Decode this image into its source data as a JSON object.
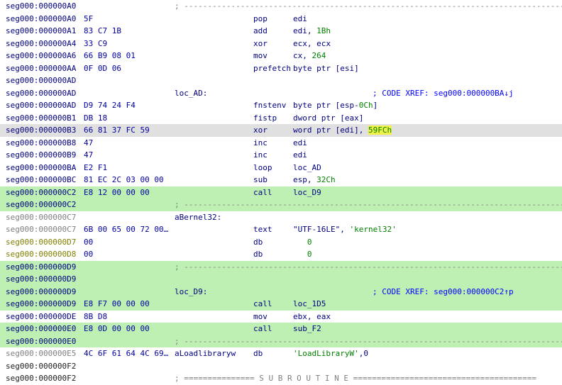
{
  "listing": {
    "rows": [
      {
        "addr": "seg000:000000A0",
        "addrColor": "default",
        "sep": "; ---------------------------------------------------------------------------------------"
      },
      {
        "addr": "seg000:000000A0",
        "bytes": "5F",
        "mnem": "pop",
        "ops": "edi"
      },
      {
        "addr": "seg000:000000A1",
        "bytes": "83 C7 1B",
        "mnem": "add",
        "ops": "edi, ",
        "num": "1Bh"
      },
      {
        "addr": "seg000:000000A4",
        "bytes": "33 C9",
        "mnem": "xor",
        "ops": "ecx, ecx"
      },
      {
        "addr": "seg000:000000A6",
        "bytes": "66 B9 08 01",
        "mnem": "mov",
        "ops": "cx, ",
        "num": "264"
      },
      {
        "addr": "seg000:000000AA",
        "bytes": "0F 0D 06",
        "mnem": "prefetch",
        "ops": "byte ptr [esi]"
      },
      {
        "addr": "seg000:000000AD"
      },
      {
        "addr": "seg000:000000AD",
        "label": "loc_AD:",
        "comment": "; CODE XREF: seg000:000000BA↓j"
      },
      {
        "addr": "seg000:000000AD",
        "bytes": "D9 74 24 F4",
        "mnem": "fnstenv",
        "ops": "byte ptr [esp-",
        "num": "0Ch",
        "opsTail": "]"
      },
      {
        "addr": "seg000:000000B1",
        "bytes": "DB 18",
        "mnem": "fistp",
        "ops": "dword ptr [eax]"
      },
      {
        "addr": "seg000:000000B3",
        "bytes": "66 81 37 FC 59",
        "mnem": "xor",
        "ops": "word ptr [edi], ",
        "hl": "59FCh",
        "selected": true
      },
      {
        "addr": "seg000:000000B8",
        "bytes": "47",
        "mnem": "inc",
        "ops": "edi"
      },
      {
        "addr": "seg000:000000B9",
        "bytes": "47",
        "mnem": "inc",
        "ops": "edi"
      },
      {
        "addr": "seg000:000000BA",
        "bytes": "E2 F1",
        "mnem": "loop",
        "ops": "loc_AD"
      },
      {
        "addr": "seg000:000000BC",
        "bytes": "81 EC 2C 03 00 00",
        "mnem": "sub",
        "ops": "esp, ",
        "num": "32Ch"
      },
      {
        "addr": "seg000:000000C2",
        "bytes": "E8 12 00 00 00",
        "mnem": "call",
        "ops": "loc_D9",
        "green": true
      },
      {
        "addr": "seg000:000000C2",
        "sep": "; ---------------------------------------------------------------------------------------",
        "green": true
      },
      {
        "addr": "seg000:000000C7",
        "addrColor": "gray",
        "label": "aBernel32:"
      },
      {
        "addr": "seg000:000000C7",
        "addrColor": "gray",
        "bytes": "6B 00 65 00 72 00…",
        "mnem": "text",
        "ops": "\"UTF-16LE\", ",
        "str": "'kernel32'"
      },
      {
        "addr": "seg000:000000D7",
        "addrColor": "data",
        "bytes": "00",
        "mnem": "db",
        "num": "   0"
      },
      {
        "addr": "seg000:000000D8",
        "addrColor": "data",
        "bytes": "00",
        "mnem": "db",
        "num": "   0"
      },
      {
        "addr": "seg000:000000D9",
        "sep": "; ---------------------------------------------------------------------------------------",
        "green": true
      },
      {
        "addr": "seg000:000000D9",
        "green": true
      },
      {
        "addr": "seg000:000000D9",
        "label": "loc_D9:",
        "comment": "; CODE XREF: seg000:000000C2↑p",
        "green": true
      },
      {
        "addr": "seg000:000000D9",
        "bytes": "E8 F7 00 00 00",
        "mnem": "call",
        "ops": "loc_1D5",
        "green": true
      },
      {
        "addr": "seg000:000000DE",
        "bytes": "8B D8",
        "mnem": "mov",
        "ops": "ebx, eax"
      },
      {
        "addr": "seg000:000000E0",
        "bytes": "E8 0D 00 00 00",
        "mnem": "call",
        "ops": "sub_F2",
        "green": true
      },
      {
        "addr": "seg000:000000E0",
        "sep": "; ---------------------------------------------------------------------------------------",
        "green": true
      },
      {
        "addr": "seg000:000000E5",
        "addrColor": "gray",
        "bytes": "4C 6F 61 64 4C 69…",
        "label": "aLoadlibraryw",
        "mnem": "db",
        "ops": "",
        "str": "'LoadLibraryW'",
        "opsTail": ",0"
      },
      {
        "addr": "seg000:000000F2",
        "addrColor": "dark"
      },
      {
        "addr": "seg000:000000F2",
        "addrColor": "dark",
        "sep": "; =============== S U B R O U T I N E ======================================="
      }
    ]
  }
}
